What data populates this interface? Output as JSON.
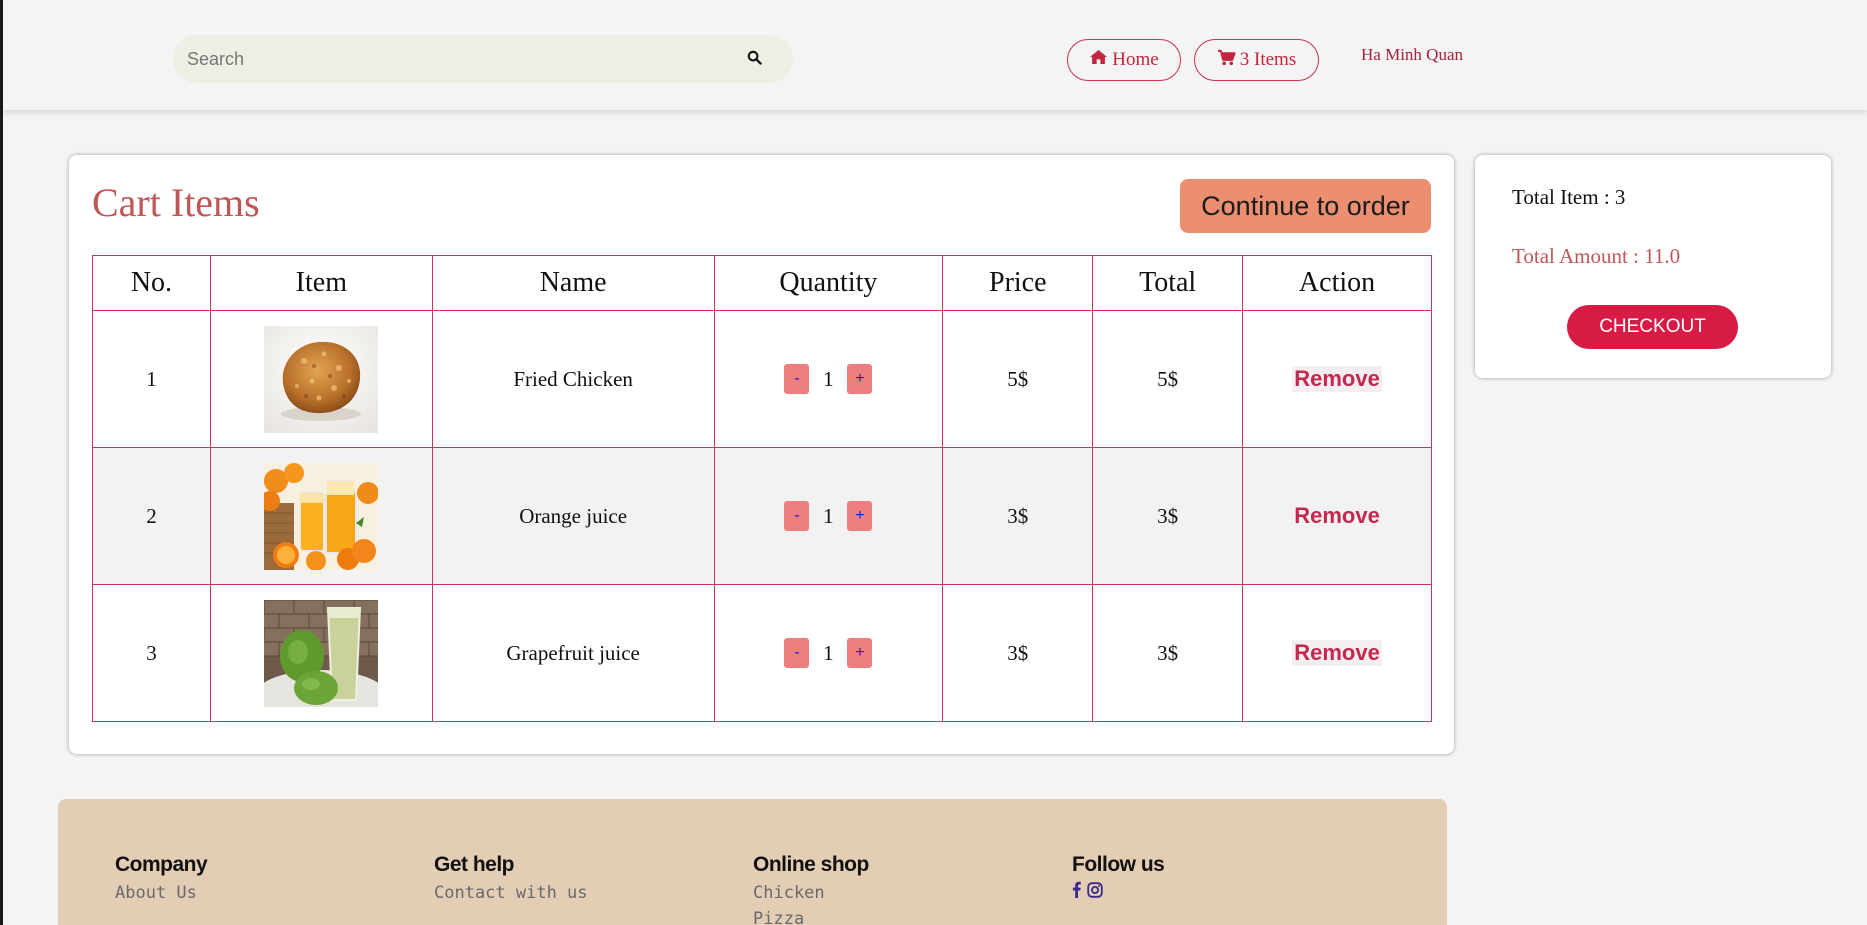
{
  "header": {
    "search": {
      "placeholder": "Search",
      "value": "",
      "icon": "search-icon"
    },
    "nav": {
      "home_label": "Home",
      "home_icon": "home-icon",
      "cart_label": "3 Items",
      "cart_icon": "cart-icon"
    },
    "user_name": "Ha Minh Quan"
  },
  "cart": {
    "title": "Cart Items",
    "continue_label": "Continue to order",
    "columns": [
      "No.",
      "Item",
      "Name",
      "Quantity",
      "Price",
      "Total",
      "Action"
    ],
    "rows": [
      {
        "no": "1",
        "image": "fried-chicken-image",
        "name": "Fried Chicken",
        "quantity": "1",
        "price": "5$",
        "total": "5$",
        "action": "Remove",
        "minus": "-",
        "plus": "+"
      },
      {
        "no": "2",
        "image": "orange-juice-image",
        "name": "Orange juice",
        "quantity": "1",
        "price": "3$",
        "total": "3$",
        "action": "Remove",
        "minus": "-",
        "plus": "+"
      },
      {
        "no": "3",
        "image": "grapefruit-juice-image",
        "name": "Grapefruit juice",
        "quantity": "1",
        "price": "3$",
        "total": "3$",
        "action": "Remove",
        "minus": "-",
        "plus": "+"
      }
    ]
  },
  "summary": {
    "total_items": "Total Item : 3",
    "total_amount": "Total Amount : 11.0",
    "checkout_label": "CHECKOUT"
  },
  "footer": {
    "columns": [
      {
        "heading": "Company",
        "links": [
          "About Us"
        ]
      },
      {
        "heading": "Get help",
        "links": [
          "Contact with us"
        ]
      },
      {
        "heading": "Online shop",
        "links": [
          "Chicken",
          "Pizza"
        ]
      },
      {
        "heading": "Follow us",
        "icons": [
          "facebook-icon",
          "instagram-icon"
        ]
      }
    ]
  },
  "colors": {
    "accent": "#c2263f",
    "title": "#c15656",
    "continue_button": "#ec8e70",
    "checkout_button": "#d81b45",
    "footer_bg": "#e4cdb5",
    "table_border": "#c9345a"
  }
}
